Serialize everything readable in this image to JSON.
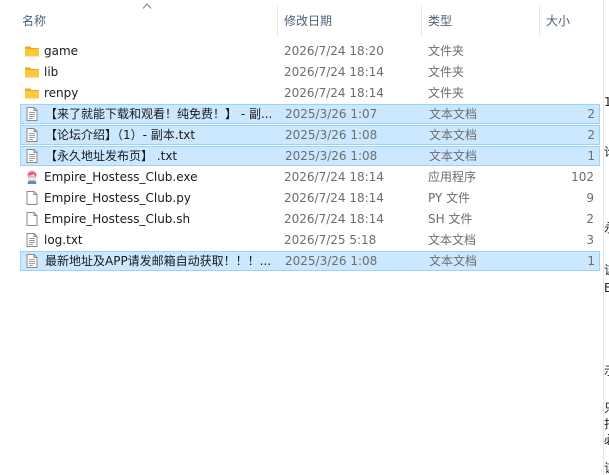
{
  "columns": {
    "name": "名称",
    "date": "修改日期",
    "type": "类型",
    "size": "大小"
  },
  "files": [
    {
      "name": "game",
      "date": "2026/7/24 18:20",
      "type": "文件夹",
      "size": "",
      "icon": "folder-icon",
      "selected": false
    },
    {
      "name": "lib",
      "date": "2026/7/24 18:14",
      "type": "文件夹",
      "size": "",
      "icon": "folder-icon",
      "selected": false
    },
    {
      "name": "renpy",
      "date": "2026/7/24 18:14",
      "type": "文件夹",
      "size": "",
      "icon": "folder-icon",
      "selected": false
    },
    {
      "name": "【来了就能下载和观看！纯免费！】 - 副...",
      "date": "2025/3/26 1:07",
      "type": "文本文档",
      "size": "2",
      "icon": "text-file-icon",
      "selected": true
    },
    {
      "name": "【论坛介绍】（1）- 副本.txt",
      "date": "2025/3/26 1:08",
      "type": "文本文档",
      "size": "2",
      "icon": "text-file-icon",
      "selected": true
    },
    {
      "name": "【永久地址发布页】 .txt",
      "date": "2025/3/26 1:08",
      "type": "文本文档",
      "size": "1",
      "icon": "text-file-icon",
      "selected": true
    },
    {
      "name": "Empire_Hostess_Club.exe",
      "date": "2026/7/24 18:14",
      "type": "应用程序",
      "size": "102",
      "icon": "app-exe-icon",
      "selected": false
    },
    {
      "name": "Empire_Hostess_Club.py",
      "date": "2026/7/24 18:14",
      "type": "PY 文件",
      "size": "9",
      "icon": "generic-file-icon",
      "selected": false
    },
    {
      "name": "Empire_Hostess_Club.sh",
      "date": "2026/7/24 18:14",
      "type": "SH 文件",
      "size": "2",
      "icon": "generic-file-icon",
      "selected": false
    },
    {
      "name": "log.txt",
      "date": "2026/7/25 5:18",
      "type": "文本文档",
      "size": "3",
      "icon": "text-file-icon",
      "selected": false
    },
    {
      "name": "最新地址及APP请发邮箱自动获取！！！...",
      "date": "2025/3/26 1:08",
      "type": "文本文档",
      "size": "1",
      "icon": "text-file-icon",
      "selected": true
    }
  ],
  "right_strip": [
    {
      "glyph": "1"
    },
    {
      "glyph": "论"
    },
    {
      "glyph": "永"
    },
    {
      "glyph": "该"
    },
    {
      "glyph": "E"
    },
    {
      "glyph": "示"
    },
    {
      "glyph": "只"
    },
    {
      "glyph": "扫"
    },
    {
      "glyph": "必"
    },
    {
      "glyph": "该"
    }
  ],
  "colors": {
    "selection_fill": "#cce8ff",
    "selection_border": "#99d1ff",
    "header_text": "#4c607a",
    "folder_yellow": "#ffc83d"
  }
}
